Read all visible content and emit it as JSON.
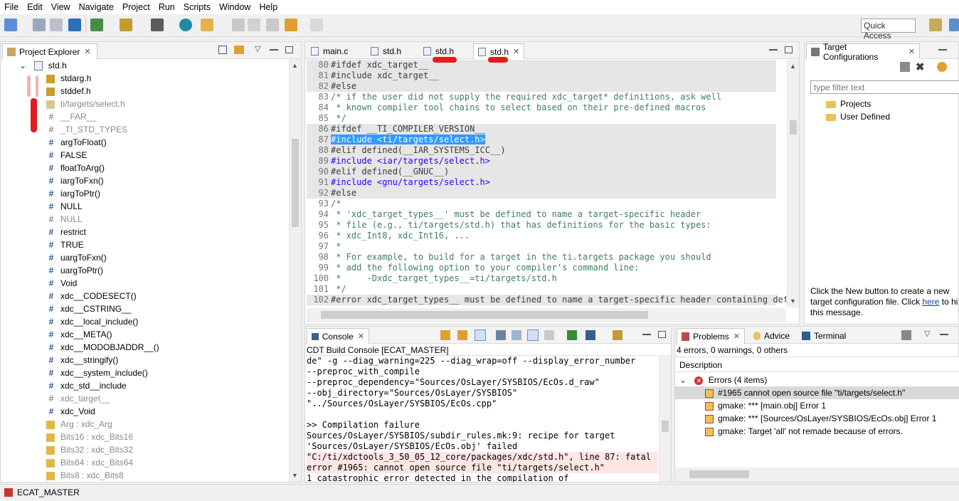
{
  "menu": [
    "File",
    "Edit",
    "View",
    "Navigate",
    "Project",
    "Run",
    "Scripts",
    "Window",
    "Help"
  ],
  "quick_access": "Quick Access",
  "explorer": {
    "tab": "Project Explorer",
    "root": "std.h",
    "items": [
      {
        "label": "stdarg.h",
        "kind": "include"
      },
      {
        "label": "stddef.h",
        "kind": "include"
      },
      {
        "label": "ti/targets/select.h",
        "kind": "include-gray"
      },
      {
        "label": "__FAR__",
        "kind": "hash-gray"
      },
      {
        "label": "_TI_STD_TYPES",
        "kind": "hash-gray"
      },
      {
        "label": "argToFloat()",
        "kind": "hash"
      },
      {
        "label": "FALSE",
        "kind": "hash"
      },
      {
        "label": "floatToArg()",
        "kind": "hash"
      },
      {
        "label": "iargToFxn()",
        "kind": "hash"
      },
      {
        "label": "iargToPtr()",
        "kind": "hash"
      },
      {
        "label": "NULL",
        "kind": "hash"
      },
      {
        "label": "NULL",
        "kind": "hash-gray"
      },
      {
        "label": "restrict",
        "kind": "hash"
      },
      {
        "label": "TRUE",
        "kind": "hash"
      },
      {
        "label": "uargToFxn()",
        "kind": "hash"
      },
      {
        "label": "uargToPtr()",
        "kind": "hash"
      },
      {
        "label": "Void",
        "kind": "hash"
      },
      {
        "label": "xdc__CODESECT()",
        "kind": "hash"
      },
      {
        "label": "xdc__CSTRING__",
        "kind": "hash"
      },
      {
        "label": "xdc__local_include()",
        "kind": "hash"
      },
      {
        "label": "xdc__META()",
        "kind": "hash"
      },
      {
        "label": "xdc__MODOBJADDR__()",
        "kind": "hash"
      },
      {
        "label": "xdc__stringify()",
        "kind": "hash"
      },
      {
        "label": "xdc__system_include()",
        "kind": "hash"
      },
      {
        "label": "xdc_std__include",
        "kind": "hash"
      },
      {
        "label": "xdc_target__",
        "kind": "hash-gray"
      },
      {
        "label": "xdc_Void",
        "kind": "hash"
      },
      {
        "label": "Arg : xdc_Arg",
        "kind": "typedef"
      },
      {
        "label": "Bits16 : xdc_Bits16",
        "kind": "typedef"
      },
      {
        "label": "Bits32 : xdc_Bits32",
        "kind": "typedef"
      },
      {
        "label": "Bits64 : xdc_Bits64",
        "kind": "typedef"
      },
      {
        "label": "Bits8 : xdc_Bits8",
        "kind": "typedef"
      }
    ]
  },
  "editor": {
    "tabs": [
      "main.c",
      "std.h",
      "std.h",
      "std.h"
    ],
    "lines": [
      {
        "n": "80",
        "t": "#ifdef xdc_target__",
        "s": "pp"
      },
      {
        "n": "81",
        "t": "#include xdc_target__",
        "s": "pp"
      },
      {
        "n": "82",
        "t": "#else",
        "s": "pp"
      },
      {
        "n": "83",
        "t": "/* if the user did not supply the required xdc_target* definitions, ask well",
        "s": "cm"
      },
      {
        "n": "84",
        "t": " * known compiler tool chains to select based on their pre-defined macros",
        "s": "cm"
      },
      {
        "n": "85",
        "t": " */",
        "s": "cm"
      },
      {
        "n": "86",
        "t": "#ifdef __TI_COMPILER_VERSION__",
        "s": "pp"
      },
      {
        "n": "87",
        "t": "#include <ti/targets/select.h>",
        "s": "sel"
      },
      {
        "n": "88",
        "t": "#elif defined(__IAR_SYSTEMS_ICC__)",
        "s": "pp"
      },
      {
        "n": "89",
        "t": "#include <iar/targets/select.h>",
        "s": "inc"
      },
      {
        "n": "90",
        "t": "#elif defined(__GNUC__)",
        "s": "pp"
      },
      {
        "n": "91",
        "t": "#include <gnu/targets/select.h>",
        "s": "inc"
      },
      {
        "n": "92",
        "t": "#else",
        "s": "pp"
      },
      {
        "n": "93",
        "t": "/*",
        "s": "cm"
      },
      {
        "n": "94",
        "t": " * 'xdc_target_types__' must be defined to name a target-specific header",
        "s": "cm"
      },
      {
        "n": "95",
        "t": " * file (e.g., ti/targets/std.h) that has definitions for the basic types:",
        "s": "cm"
      },
      {
        "n": "96",
        "t": " * xdc_Int8, xdc_Int16, ...",
        "s": "cm"
      },
      {
        "n": "97",
        "t": " *",
        "s": "cm"
      },
      {
        "n": "98",
        "t": " * For example, to build for a target in the ti.targets package you should",
        "s": "cm"
      },
      {
        "n": "99",
        "t": " * add the following option to your compiler's command line:",
        "s": "cm"
      },
      {
        "n": "100",
        "t": " *     -Dxdc_target_types__=ti/targets/std.h",
        "s": "cm"
      },
      {
        "n": "101",
        "t": " */",
        "s": "cm"
      },
      {
        "n": "102",
        "t": "#error xdc_target_types__ must be defined to name a target-specific header containing defi",
        "s": "pp"
      }
    ]
  },
  "target": {
    "tab": "Target Configurations",
    "filter_placeholder": "type filter text",
    "folders": [
      "Projects",
      "User Defined"
    ],
    "help1": "Click the New button to create a new",
    "help2a": "target configuration file. Click ",
    "help2link": "here",
    "help2b": " to hi",
    "help3": "this message."
  },
  "console": {
    "tab": "Console",
    "title": "CDT Build Console [ECAT_MASTER]",
    "lines": [
      {
        "t": "de\" -g --diag_warning=225 --diag_wrap=off --display_error_number",
        "e": false
      },
      {
        "t": "--preproc_with_compile",
        "e": false
      },
      {
        "t": "--preproc_dependency=\"Sources/OsLayer/SYSBIOS/EcOs.d_raw\"",
        "e": false
      },
      {
        "t": "--obj_directory=\"Sources/OsLayer/SYSBIOS\"",
        "e": false
      },
      {
        "t": "\"../Sources/OsLayer/SYSBIOS/EcOs.cpp\"",
        "e": false
      },
      {
        "t": "",
        "e": false
      },
      {
        "t": ">> Compilation failure",
        "e": false
      },
      {
        "t": "Sources/OsLayer/SYSBIOS/subdir_rules.mk:9: recipe for target",
        "e": false
      },
      {
        "t": "'Sources/OsLayer/SYSBIOS/EcOs.obj' failed",
        "e": false
      },
      {
        "t": "\"C:/ti/xdctools_3_50_05_12_core/packages/xdc/std.h\", line 87: fatal",
        "e": true
      },
      {
        "t": "error #1965: cannot open source file \"ti/targets/select.h\"",
        "e": true
      },
      {
        "t": "1 catastrophic error detected in the compilation of",
        "e": false
      }
    ]
  },
  "problems": {
    "tabs": [
      "Problems",
      "Advice",
      "Terminal"
    ],
    "summary": "4 errors, 0 warnings, 0 others",
    "col": "Description",
    "group": "Errors (4 items)",
    "items": [
      "#1965 cannot open source file \"ti/targets/select.h\"",
      "gmake: *** [main.obj] Error 1",
      "gmake: *** [Sources/OsLayer/SYSBIOS/EcOs.obj] Error 1",
      "gmake: Target 'all' not remade because of errors."
    ]
  },
  "status": {
    "project": "ECAT_MASTER"
  },
  "colors": {
    "accent": "#3399ff",
    "error": "#e51b1b",
    "keyword": "#7f0055",
    "comment": "#3f7f5f",
    "string": "#2a00ff"
  }
}
